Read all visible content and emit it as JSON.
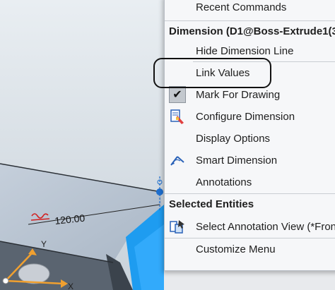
{
  "viewport": {
    "dimension_value": "120.00",
    "axis_y_label": "Y",
    "axis_x_label": "X",
    "colors": {
      "model_blue": "#1e9cf0",
      "axis_orange": "#f0a030",
      "dimension_red": "#d22020"
    }
  },
  "menu": {
    "items": [
      {
        "id": "recent",
        "label": "Recent Commands"
      },
      {
        "id": "section_dimension",
        "label": "Dimension (D1@Boss-Extrude1(3"
      },
      {
        "id": "hide_dim_line",
        "label": "Hide Dimension Line"
      },
      {
        "id": "link_values",
        "label": "Link Values"
      },
      {
        "id": "mark_for_drawing",
        "label": "Mark For Drawing",
        "icon": "check-icon",
        "checked": true
      },
      {
        "id": "configure_dimension",
        "label": "Configure Dimension",
        "icon": "configure-dimension-icon"
      },
      {
        "id": "display_options",
        "label": "Display Options"
      },
      {
        "id": "smart_dimension",
        "label": "Smart Dimension",
        "icon": "smart-dimension-icon"
      },
      {
        "id": "annotations",
        "label": "Annotations"
      },
      {
        "id": "section_selected",
        "label": "Selected Entities"
      },
      {
        "id": "select_annotation_view",
        "label": "Select Annotation View (*Fron",
        "icon": "annotation-view-icon"
      },
      {
        "id": "customize_menu",
        "label": "Customize Menu"
      }
    ],
    "check_glyph": "✔"
  }
}
